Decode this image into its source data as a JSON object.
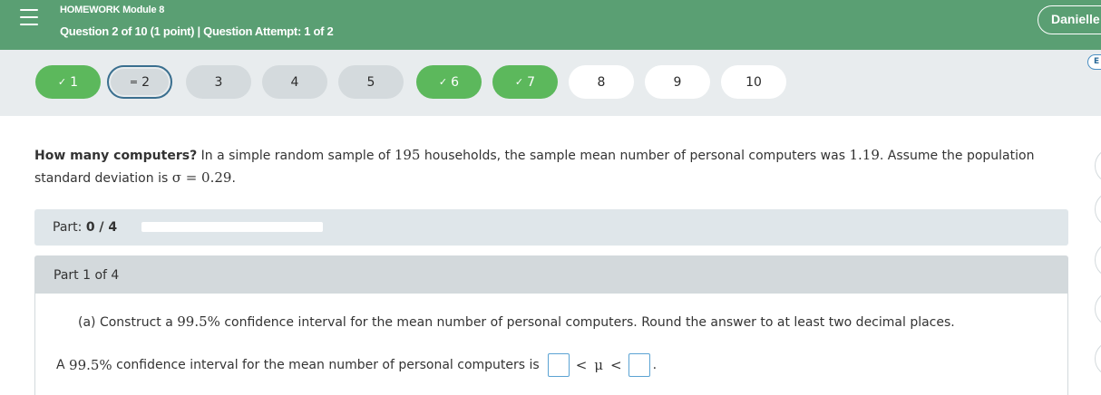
{
  "header": {
    "module_title": "HOMEWORK Module 8",
    "question_info": "Question 2 of 10 (1 point)  |  Question Attempt: 1 of 2",
    "user_name": "Danielle",
    "menu_icon": "hamburger-menu-icon"
  },
  "nav": {
    "questions": [
      {
        "label": "1",
        "state": "answered",
        "mark": "✓"
      },
      {
        "label": "2",
        "state": "current",
        "mark": "="
      },
      {
        "label": "3",
        "state": "unanswered",
        "mark": ""
      },
      {
        "label": "4",
        "state": "unanswered",
        "mark": ""
      },
      {
        "label": "5",
        "state": "unanswered",
        "mark": ""
      },
      {
        "label": "6",
        "state": "answered",
        "mark": "✓"
      },
      {
        "label": "7",
        "state": "answered",
        "mark": "✓"
      },
      {
        "label": "8",
        "state": "unvisited",
        "mark": ""
      },
      {
        "label": "9",
        "state": "unvisited",
        "mark": ""
      },
      {
        "label": "10",
        "state": "unvisited",
        "mark": ""
      }
    ],
    "side_badge": "E"
  },
  "question": {
    "bold_lead": "How many computers?",
    "text_1": " In a simple random sample of ",
    "n": "195",
    "text_2": " households, the sample mean number of personal computers was ",
    "mean": "1.19",
    "text_3": ". Assume the population standard deviation is ",
    "sigma": "σ = 0.29",
    "text_4": "."
  },
  "part_progress": {
    "label": "Part:",
    "score": "0 / 4",
    "progress_fraction": 0
  },
  "part": {
    "heading": "Part 1 of 4",
    "prompt_a": "(a) Construct a ",
    "conf_level": "99.5%",
    "prompt_b": " confidence interval for the mean number of personal computers. Round the answer to at least two decimal places.",
    "answer_a": "A ",
    "answer_conf": "99.5%",
    "answer_b": " confidence interval for the mean number of personal computers is",
    "lt1": "<",
    "mu": "μ",
    "lt2": "<",
    "period": ".",
    "lower_value": "",
    "upper_value": ""
  },
  "colors": {
    "header": "#5a9f73",
    "answered": "#5cb85c",
    "current_border": "#3a6f8f",
    "input_border": "#5ba3d3"
  }
}
